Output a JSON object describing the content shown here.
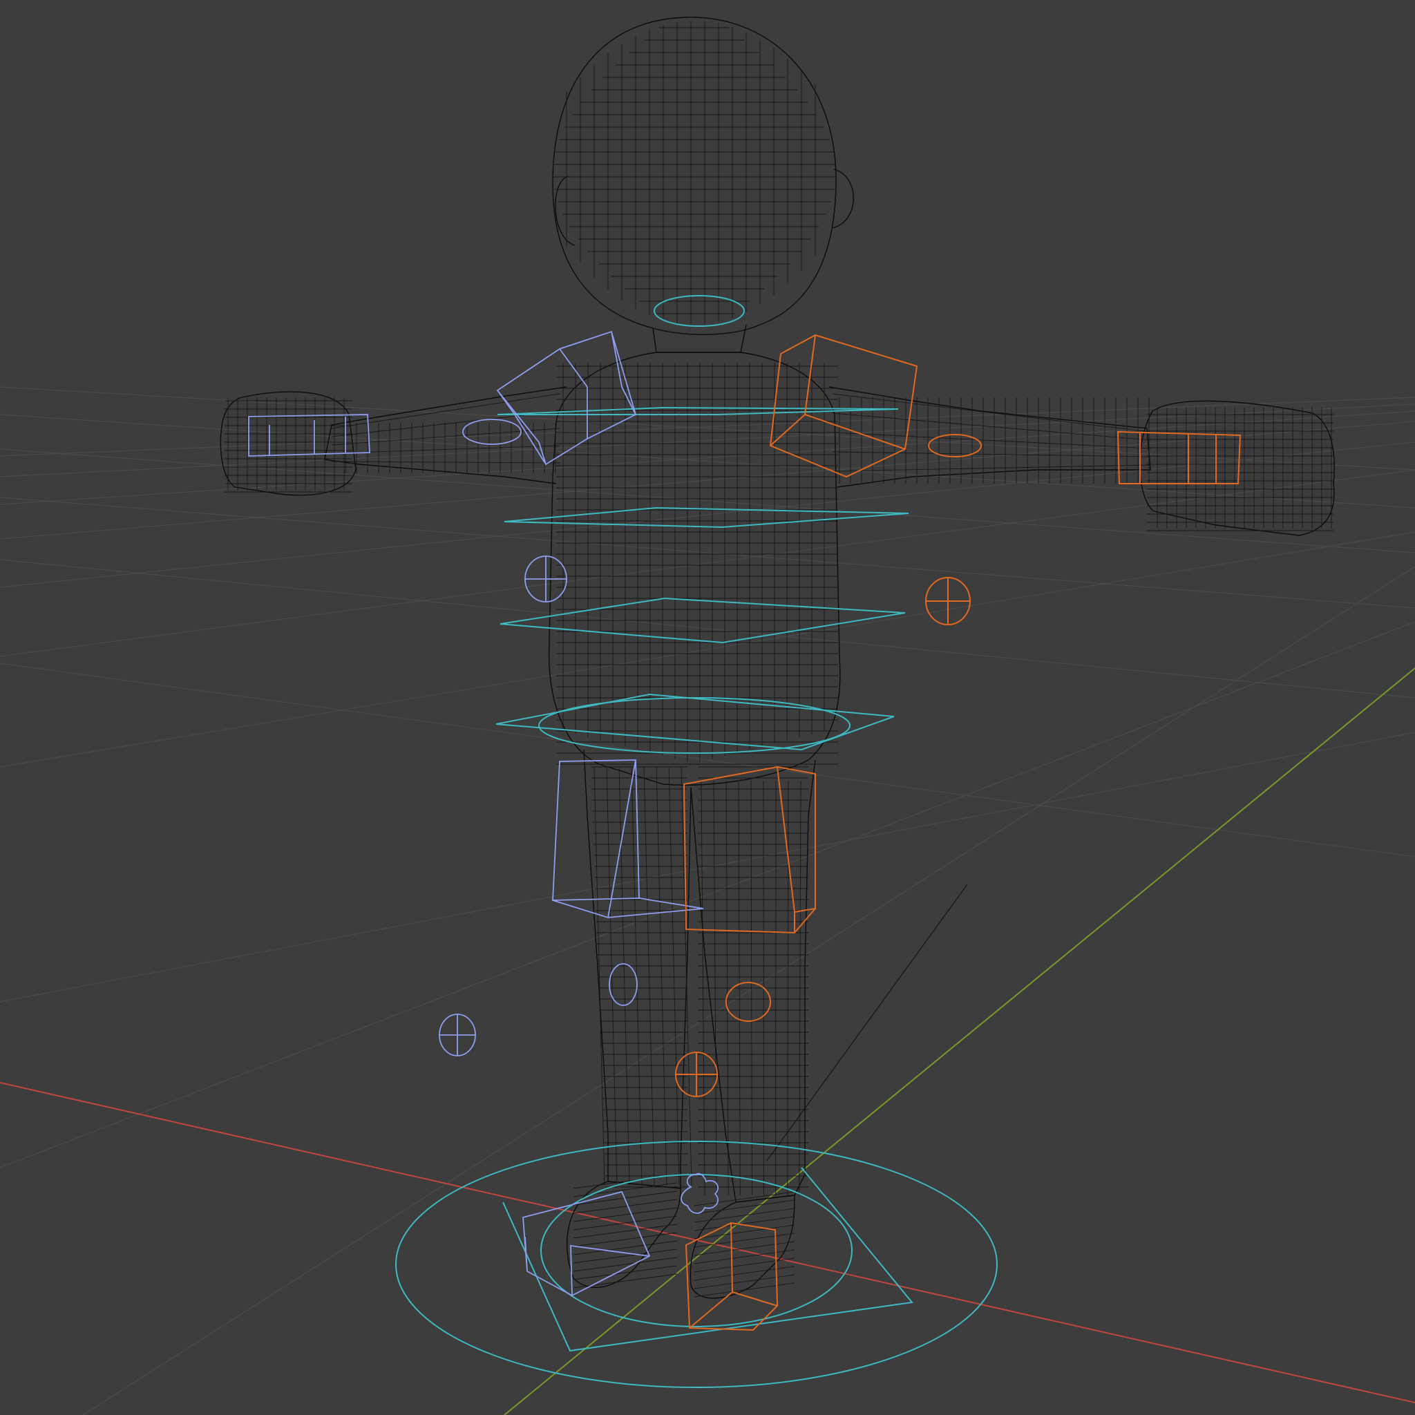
{
  "app": {
    "view": "3D Viewport",
    "shading_mode": "wireframe",
    "object": "character-mesh",
    "rig": "control-rig"
  },
  "colors": {
    "background": "#3d3d3d",
    "grid": "#4b4b4b",
    "x_axis": "#c0463f",
    "y_axis": "#7a9a2a",
    "mesh_wire": "#0c0c0c",
    "center_controls": "#3fb9c2",
    "left_side_controls": "#8f9ef0",
    "right_side_controls": "#e06a21"
  },
  "controls": {
    "center": [
      "root-circle",
      "hips-ring",
      "spine-ring",
      "chest-ring",
      "upper-chest-ring",
      "neck-ring"
    ],
    "left": [
      "shoulder-cube",
      "hand-ik",
      "elbow-pole",
      "thigh-cube",
      "knee-pole",
      "foot-cube"
    ],
    "right": [
      "shoulder-cube",
      "hand-ik",
      "elbow-pole",
      "thigh-cube",
      "knee-pole",
      "foot-cube"
    ]
  }
}
